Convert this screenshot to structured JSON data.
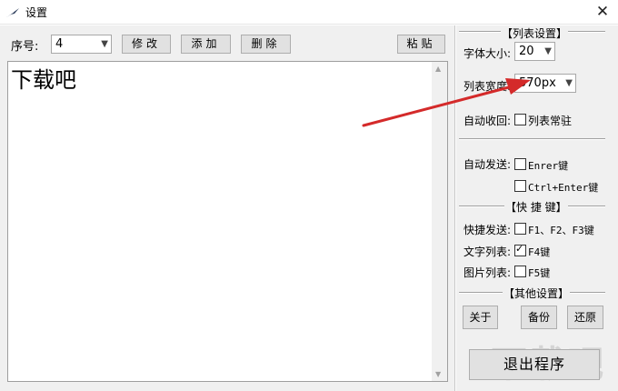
{
  "window": {
    "title": "设置",
    "close_glyph": "✕"
  },
  "toolbar": {
    "index_label": "序号:",
    "index_value": "4",
    "edit_label": "修改",
    "add_label": "添加",
    "delete_label": "删除",
    "paste_label": "粘贴"
  },
  "editor": {
    "text": "下载吧"
  },
  "list_settings": {
    "section_title": "【列表设置】",
    "font_size_label": "字体大小:",
    "font_size_value": "20",
    "list_width_label": "列表宽度:",
    "list_width_value": "570px",
    "auto_collapse_label": "自动收回:",
    "pin_list_label": "列表常驻",
    "pin_list_checked": false,
    "auto_send_label": "自动发送:",
    "enter_key_label": "Enrer键",
    "enter_key_checked": false,
    "ctrl_enter_label": "Ctrl+Enter键",
    "ctrl_enter_checked": false
  },
  "hotkeys": {
    "section_title": "【快 捷 键】",
    "quick_send_label": "快捷发送:",
    "quick_send_keys": "F1、F2、F3键",
    "quick_send_checked": false,
    "text_list_label": "文字列表:",
    "text_list_key": "F4键",
    "text_list_checked": true,
    "image_list_label": "图片列表:",
    "image_list_key": "F5键",
    "image_list_checked": false
  },
  "other": {
    "section_title": "【其他设置】",
    "about_label": "关于",
    "backup_label": "备份",
    "restore_label": "还原"
  },
  "exit_label": "退出程序",
  "watermark": "下载吧",
  "colors": {
    "annotation_arrow": "#d42a2a",
    "window_bg": "#f0f0f0"
  },
  "icons": {
    "app": "feather-icon",
    "dropdown": "chevron-down-icon"
  }
}
